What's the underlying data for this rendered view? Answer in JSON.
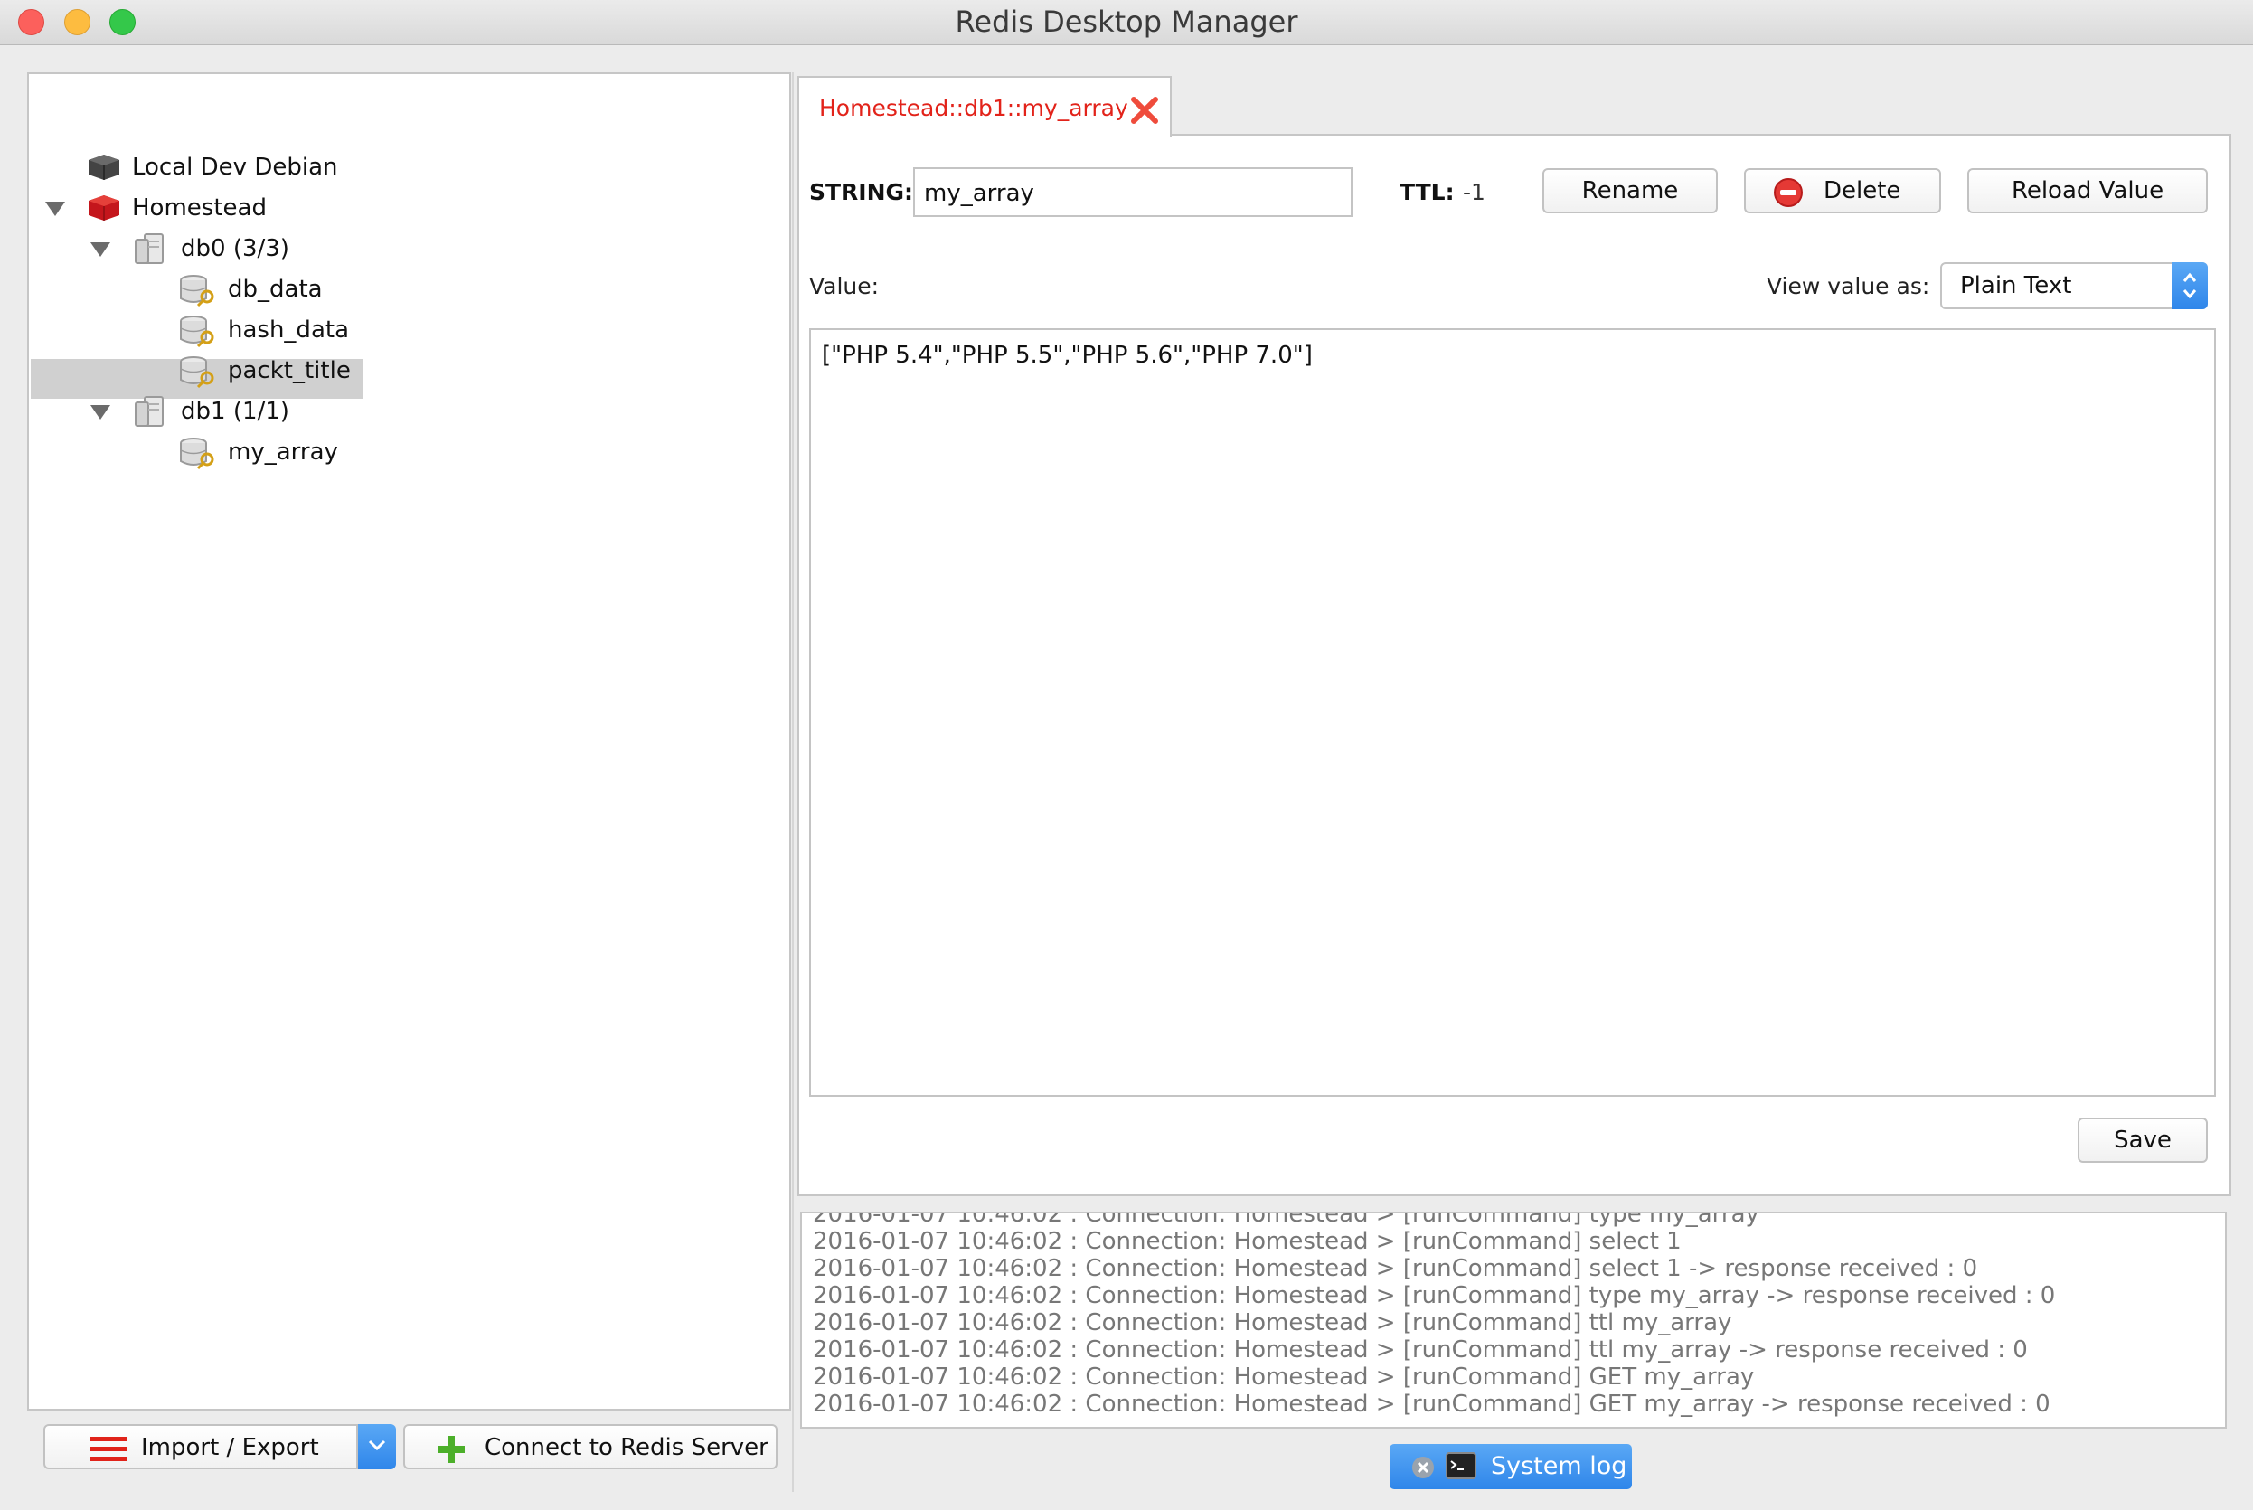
{
  "window": {
    "title": "Redis Desktop Manager"
  },
  "tree": {
    "items": [
      {
        "label": "Local Dev Debian",
        "type": "server"
      },
      {
        "label": "Homestead",
        "type": "server",
        "expanded": true
      },
      {
        "label": "db0 (3/3)",
        "type": "database",
        "expanded": true
      },
      {
        "label": "db_data",
        "type": "key"
      },
      {
        "label": "hash_data",
        "type": "key"
      },
      {
        "label": "packt_title",
        "type": "key"
      },
      {
        "label": "db1 (1/1)",
        "type": "database",
        "expanded": true
      },
      {
        "label": "my_array",
        "type": "key",
        "selected": true
      }
    ]
  },
  "bottom_buttons": {
    "import_export": "Import / Export",
    "connect": "Connect to Redis Server"
  },
  "tab": {
    "title": "Homestead::db1::my_array"
  },
  "key_editor": {
    "type_label": "STRING:",
    "key_name": "my_array",
    "ttl_label": "TTL:",
    "ttl_value": "-1",
    "rename_label": "Rename",
    "delete_label": "Delete",
    "reload_label": "Reload Value",
    "value_label": "Value:",
    "view_as_label": "View value as:",
    "view_as_selected": "Plain Text",
    "value": "[\"PHP 5.4\",\"PHP 5.5\",\"PHP 5.6\",\"PHP 7.0\"]",
    "save_label": "Save"
  },
  "log": {
    "lines": [
      "2016-01-07 10:46:02 : Connection: Homestead > [runCommand] type my_array",
      "2016-01-07 10:46:02 : Connection: Homestead > [runCommand] select 1",
      "2016-01-07 10:46:02 : Connection: Homestead > [runCommand] select 1 -> response received : 0",
      "2016-01-07 10:46:02 : Connection: Homestead > [runCommand] type my_array -> response received : 0",
      "2016-01-07 10:46:02 : Connection: Homestead > [runCommand] ttl my_array",
      "2016-01-07 10:46:02 : Connection: Homestead > [runCommand] ttl my_array -> response received : 0",
      "2016-01-07 10:46:02 : Connection: Homestead > [runCommand] GET my_array",
      "2016-01-07 10:46:02 : Connection: Homestead > [runCommand] GET my_array -> response received : 0"
    ]
  },
  "system_log": {
    "label": "System log"
  },
  "colors": {
    "tab_title": "#e2231a",
    "system_log_button": "#3a8ff0",
    "selection": "#d0d0d0"
  }
}
